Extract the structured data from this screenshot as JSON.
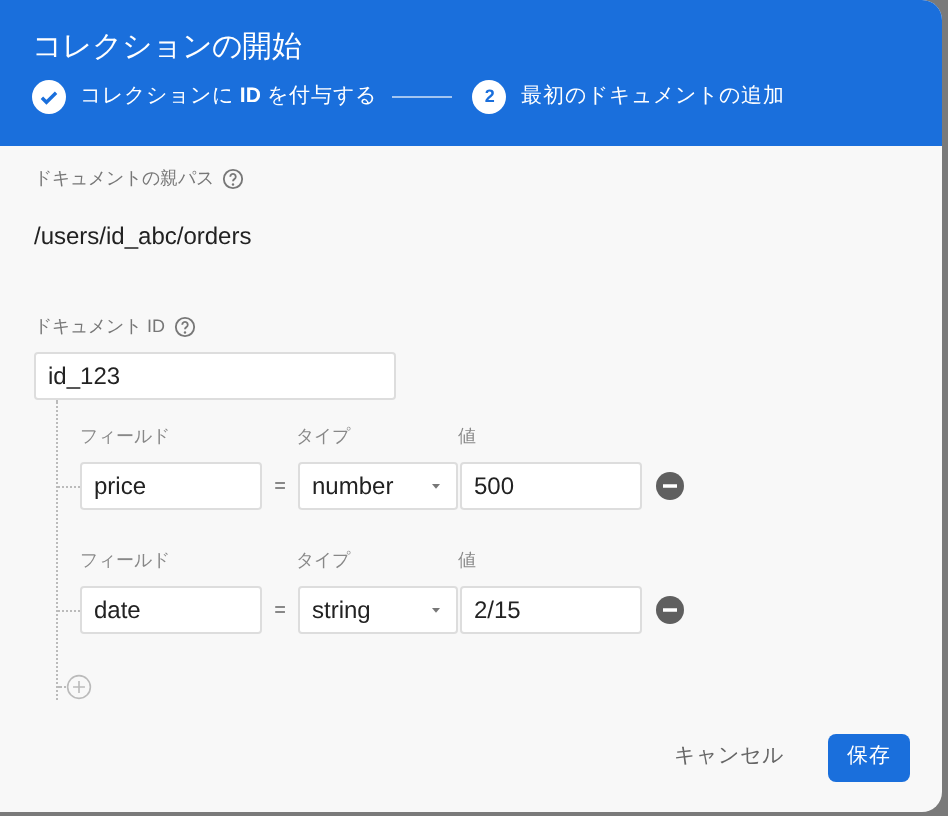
{
  "dialog": {
    "title": "コレクションの開始"
  },
  "steps": [
    {
      "label": "コレクションに **ID** を付与する",
      "completed": true
    },
    {
      "label": "最初のドキュメントの追加",
      "number": "2",
      "completed": false
    }
  ],
  "parent_path": {
    "label": "ドキュメントの親パス",
    "value": "/users/id_abc/orders"
  },
  "document_id": {
    "label": "ドキュメント ID",
    "value": "id_123"
  },
  "fields": [
    {
      "field_label": "フィールド",
      "type_label": "タイプ",
      "value_label": "値",
      "field": "price",
      "equals": "=",
      "type": "number",
      "value": "500"
    },
    {
      "field_label": "フィールド",
      "type_label": "タイプ",
      "value_label": "値",
      "field": "date",
      "equals": "=",
      "type": "string",
      "value": "2/15"
    }
  ],
  "buttons": [
    {
      "label": "キャンセル",
      "kind": "text"
    },
    {
      "label": "保存",
      "kind": "primary"
    }
  ]
}
